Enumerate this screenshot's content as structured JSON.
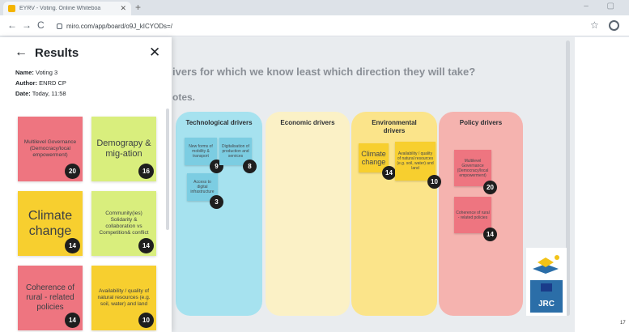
{
  "browser": {
    "tab_title": "EYRV - Voting. Online Whiteboa",
    "tab_close": "✕",
    "new_tab": "+",
    "url": "miro.com/app/board/o9J_kICYODs=/",
    "back": "←",
    "forward": "→",
    "reload": "C",
    "star": "☆",
    "window_controls": "– ▢"
  },
  "panel": {
    "back_icon": "←",
    "title": "Results",
    "close_icon": "✕",
    "name_label": "Name:",
    "name_value": "Voting 3",
    "author_label": "Author:",
    "author_value": "ENRD CP",
    "date_label": "Date:",
    "date_value": "Today, 11:58",
    "cards": [
      {
        "text": "Multilevel Governance (Democracy/local empowerment)",
        "votes": "20",
        "color": "#ee7580"
      },
      {
        "text": "Demograpy & mig-ation",
        "votes": "16",
        "color": "#d9ee7d"
      },
      {
        "text": "Climate change",
        "votes": "14",
        "color": "#f7cf2f"
      },
      {
        "text": "Community(ies) Solidarity & collaboration vs Competition& conflict",
        "votes": "14",
        "color": "#d9ee7d"
      },
      {
        "text": "Coherence of rural - related policies",
        "votes": "14",
        "color": "#ee7580"
      },
      {
        "text": "Availability / quality of natural resources (e.g. soil, water) and land",
        "votes": "10",
        "color": "#f7cf2f"
      }
    ]
  },
  "board": {
    "heading": "ivers for which we know least which direction they will take?",
    "subheading": "otes.",
    "columns": [
      {
        "title": "Technological drivers",
        "color": "#a6e2ef"
      },
      {
        "title": "Economic drivers",
        "color": "#fbf1c6"
      },
      {
        "title": "Environmental drivers",
        "color": "#fbe48a"
      },
      {
        "title": "Policy drivers",
        "color": "#f5b3af"
      }
    ],
    "stickies": [
      {
        "text": "New forms of mobility & transport",
        "votes": "9"
      },
      {
        "text": "Digitalisation of production and services",
        "votes": "8"
      },
      {
        "text": "Access to digital infrastructure",
        "votes": "3"
      },
      {
        "text": "Climate change",
        "votes": "14"
      },
      {
        "text": "Availability / quality of natural resources (e.g. soil, water) and land",
        "votes": "10"
      },
      {
        "text": "Multilevel Governance (Democracy/local empowerment)",
        "votes": "20"
      },
      {
        "text": "Coherence of rural - related policies",
        "votes": "14"
      }
    ],
    "logo_text": "JRC",
    "corner_number": "17"
  }
}
